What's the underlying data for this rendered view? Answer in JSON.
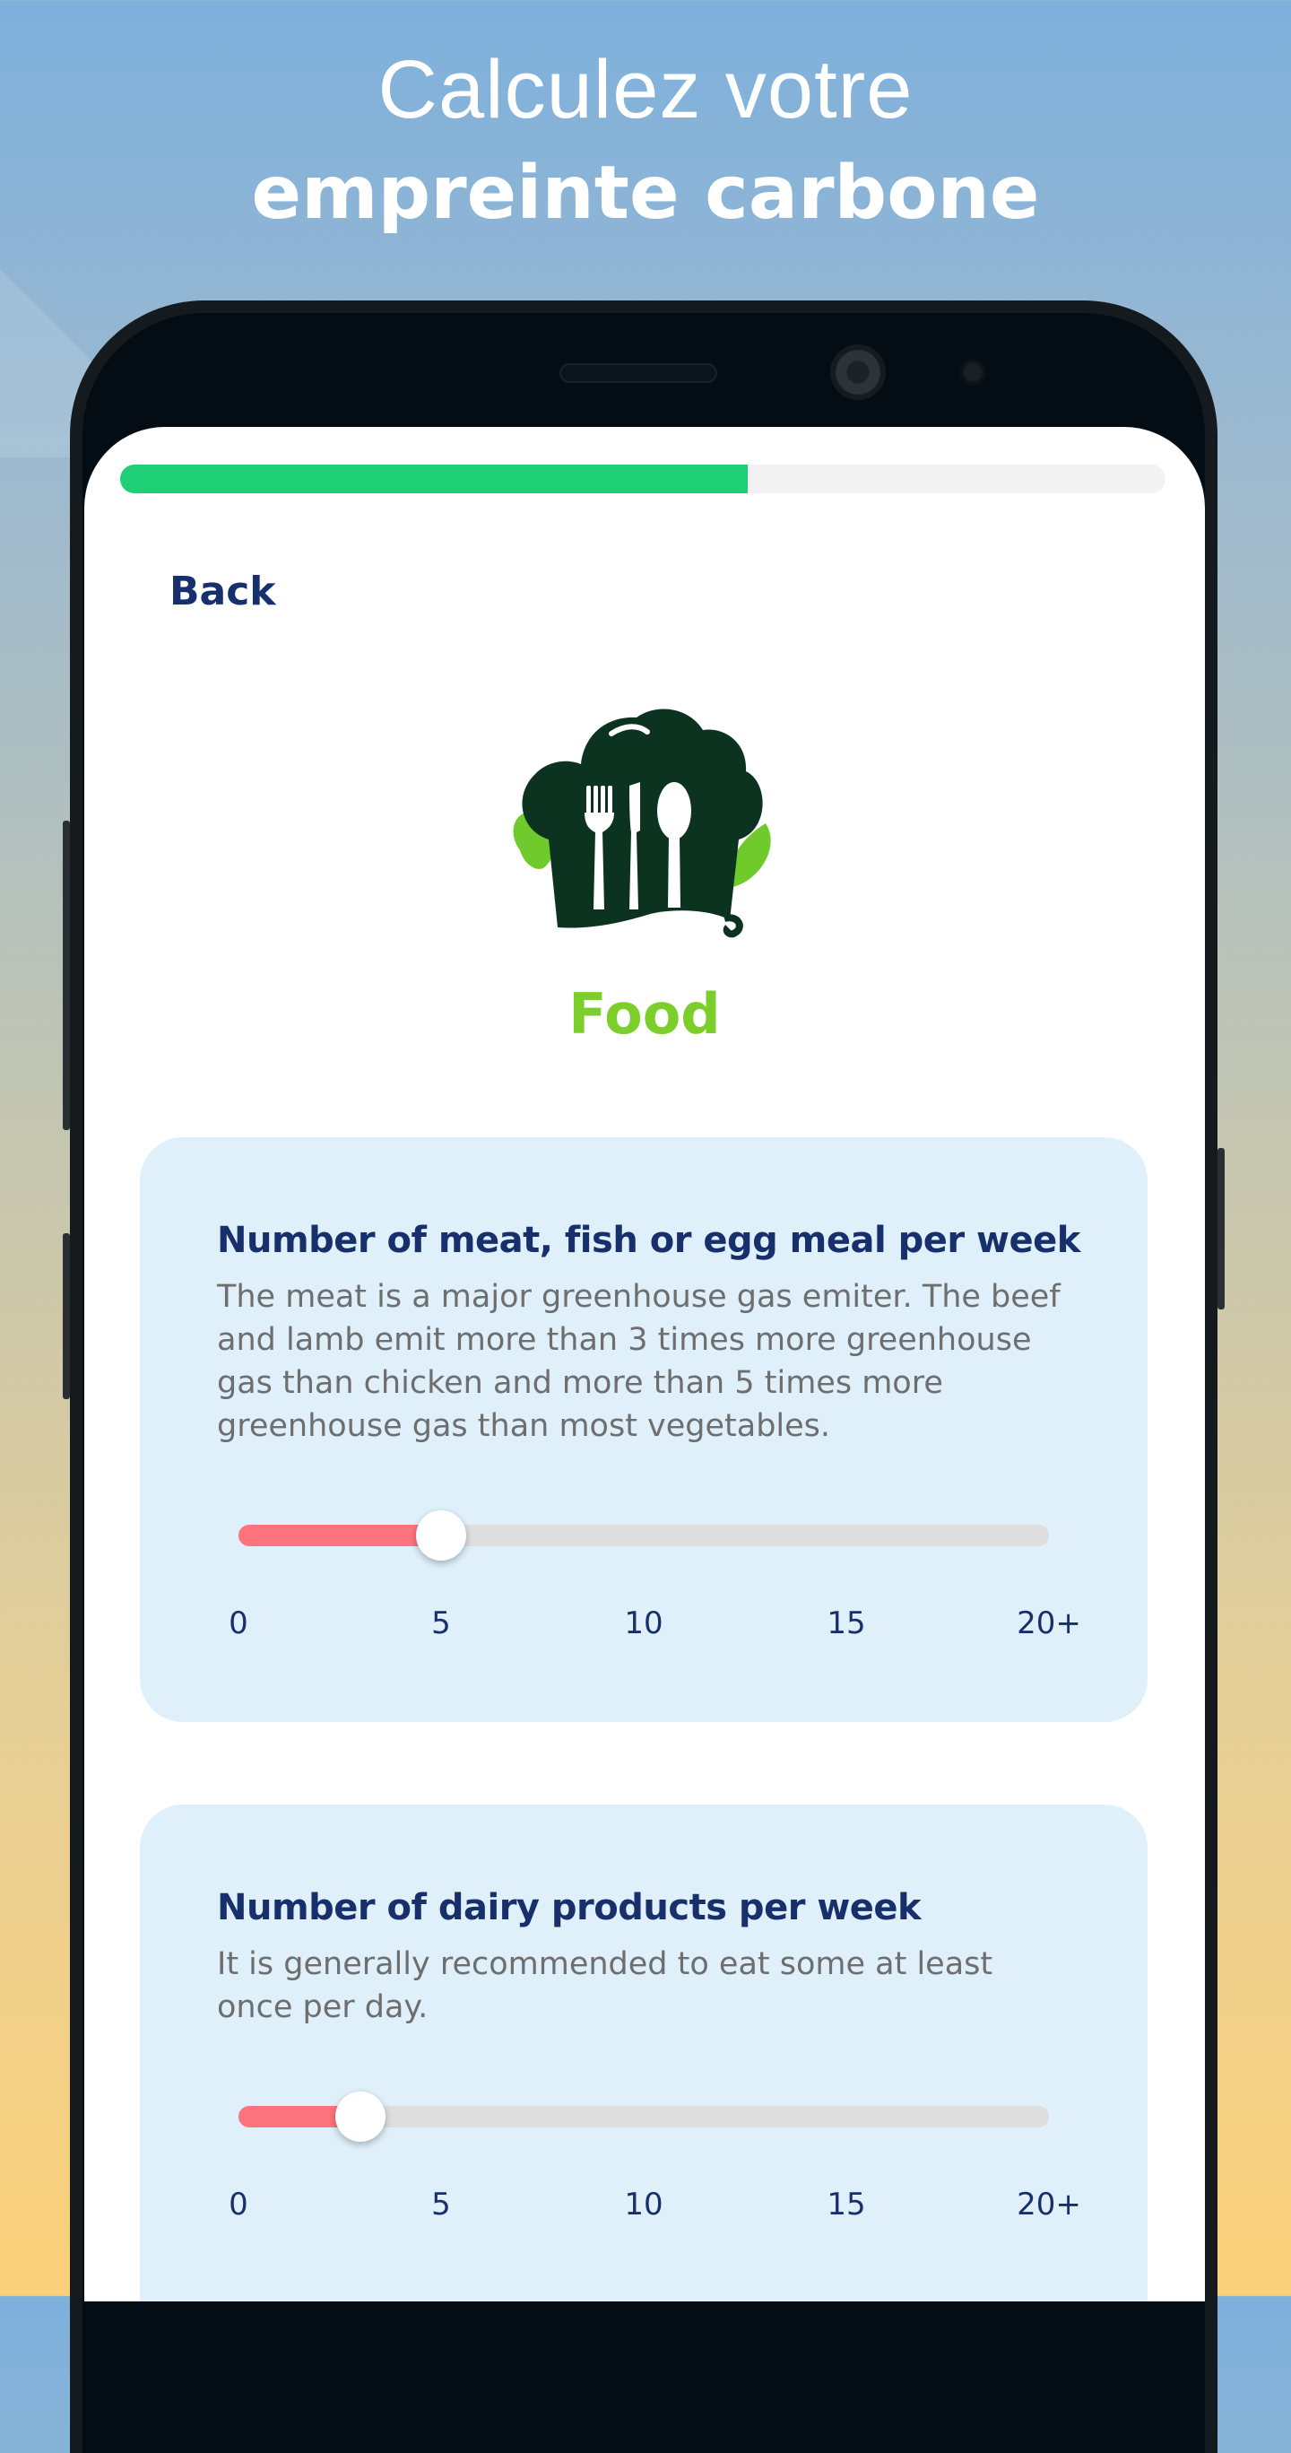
{
  "banner": {
    "line1": "Calculez votre",
    "line2": "empreinte carbone"
  },
  "progress": {
    "fraction": 0.6
  },
  "nav": {
    "back_label": "Back"
  },
  "category": {
    "title": "Food",
    "icon": "chef-hat-cutlery-icon"
  },
  "questions": [
    {
      "title": "Number of meat, fish or egg meal per week",
      "description": "The meat is a major greenhouse gas emiter. The beef and lamb emit more than 3 times more greenhouse gas than chicken and more than 5 times more greenhouse gas than most vegetables.",
      "slider": {
        "min": 0,
        "max": 20,
        "value": 5,
        "ticks": [
          "0",
          "5",
          "10",
          "15",
          "20+"
        ]
      }
    },
    {
      "title": "Number of dairy products per week",
      "description": "It is generally recommended to eat some at least once per day.",
      "slider": {
        "min": 0,
        "max": 20,
        "value": 3,
        "ticks": [
          "0",
          "5",
          "10",
          "15",
          "20+"
        ]
      }
    }
  ],
  "colors": {
    "progress_fill": "#1fcf75",
    "slider_fill": "#fd737e",
    "slider_track": "#dedede",
    "card_bg": "#dff0fb",
    "title_navy": "#17306b",
    "category_green": "#7cce2b"
  }
}
